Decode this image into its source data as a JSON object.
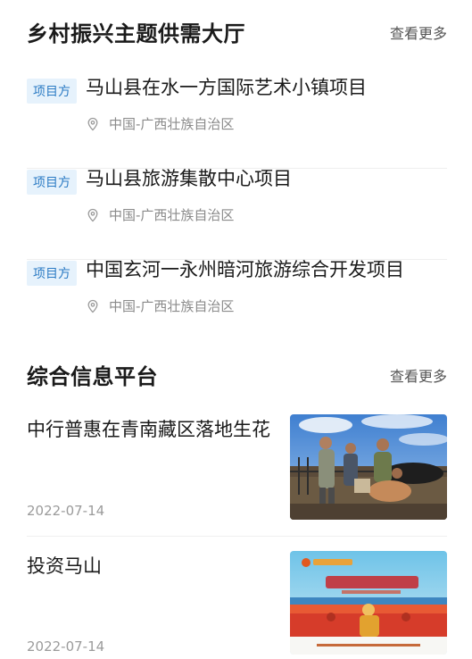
{
  "sections": {
    "supply": {
      "title": "乡村振兴主题供需大厅",
      "more": "查看更多"
    },
    "info": {
      "title": "综合信息平台",
      "more": "查看更多"
    }
  },
  "projects": [
    {
      "tag": "项目方",
      "title": "马山县在水一方国际艺术小镇项目",
      "location": "中国-广西壮族自治区"
    },
    {
      "tag": "项目方",
      "title": "马山县旅游集散中心项目",
      "location": "中国-广西壮族自治区"
    },
    {
      "tag": "项目方",
      "title": "中国玄河一永州暗河旅游综合开发项目",
      "location": "中国-广西壮族自治区"
    }
  ],
  "news": [
    {
      "title": "中行普惠在青南藏区落地生花",
      "date": "2022-07-14"
    },
    {
      "title": "投资马山",
      "date": "2022-07-14"
    }
  ]
}
